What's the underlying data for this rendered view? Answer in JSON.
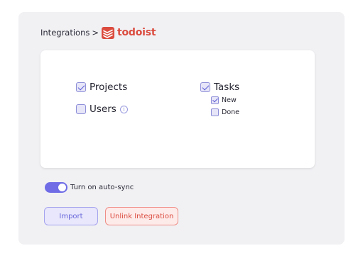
{
  "breadcrumb": {
    "parent": "Integrations",
    "separator": ">",
    "brand": "todoist"
  },
  "options": {
    "projects": {
      "label": "Projects",
      "checked": true
    },
    "users": {
      "label": "Users",
      "checked": false,
      "info_icon": "info-icon"
    },
    "tasks": {
      "label": "Tasks",
      "checked": true,
      "children": [
        {
          "label": "New",
          "checked": true
        },
        {
          "label": "Done",
          "checked": false
        }
      ]
    }
  },
  "autosync": {
    "label": "Turn on auto-sync",
    "enabled": true
  },
  "buttons": {
    "import": "Import",
    "unlink": "Unlink Integration"
  },
  "colors": {
    "accent": "#6f6ce6",
    "brand": "#db4c3f",
    "danger": "#db4c3f"
  }
}
